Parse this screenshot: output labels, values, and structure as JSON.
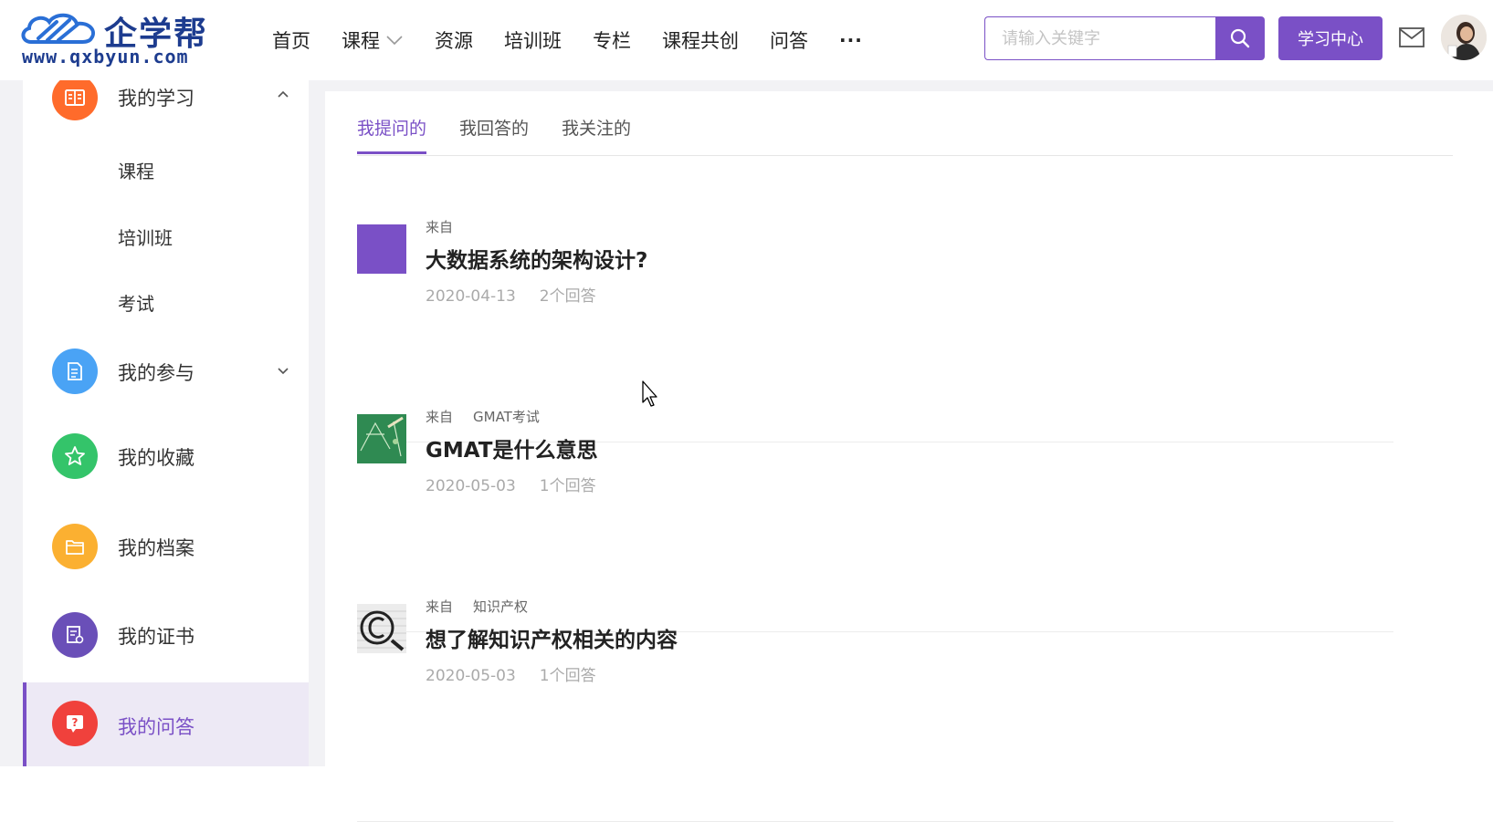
{
  "logo": {
    "name": "企学帮",
    "url": "www.qxbyun.com"
  },
  "nav": {
    "items": [
      "首页",
      "课程",
      "资源",
      "培训班",
      "专栏",
      "课程共创",
      "问答"
    ],
    "more": "···"
  },
  "search": {
    "placeholder": "请输入关键字",
    "value": ""
  },
  "header": {
    "study_center": "学习中心"
  },
  "sidebar": {
    "my_learning": "我的学习",
    "sub_items": [
      "课程",
      "培训班",
      "考试"
    ],
    "my_participation": "我的参与",
    "my_favorites": "我的收藏",
    "my_archive": "我的档案",
    "my_certificates": "我的证书",
    "my_qa": "我的问答"
  },
  "tabs": [
    "我提问的",
    "我回答的",
    "我关注的"
  ],
  "questions": [
    {
      "from": "来自",
      "source": "",
      "title": "大数据系统的架构设计?",
      "date": "2020-04-13",
      "answers": "2个回答"
    },
    {
      "from": "来自",
      "source": "GMAT考试",
      "title": "GMAT是什么意思",
      "date": "2020-05-03",
      "answers": "1个回答"
    },
    {
      "from": "来自",
      "source": "知识产权",
      "title": "想了解知识产权相关的内容",
      "date": "2020-05-03",
      "answers": "1个回答"
    }
  ],
  "colors": {
    "accent": "#7a50c6",
    "orange": "#ff6b2b",
    "blue": "#4aa3f5",
    "green": "#34c46a",
    "yellow": "#fbb031",
    "indigo": "#6a4fb8",
    "red": "#f0413c"
  }
}
